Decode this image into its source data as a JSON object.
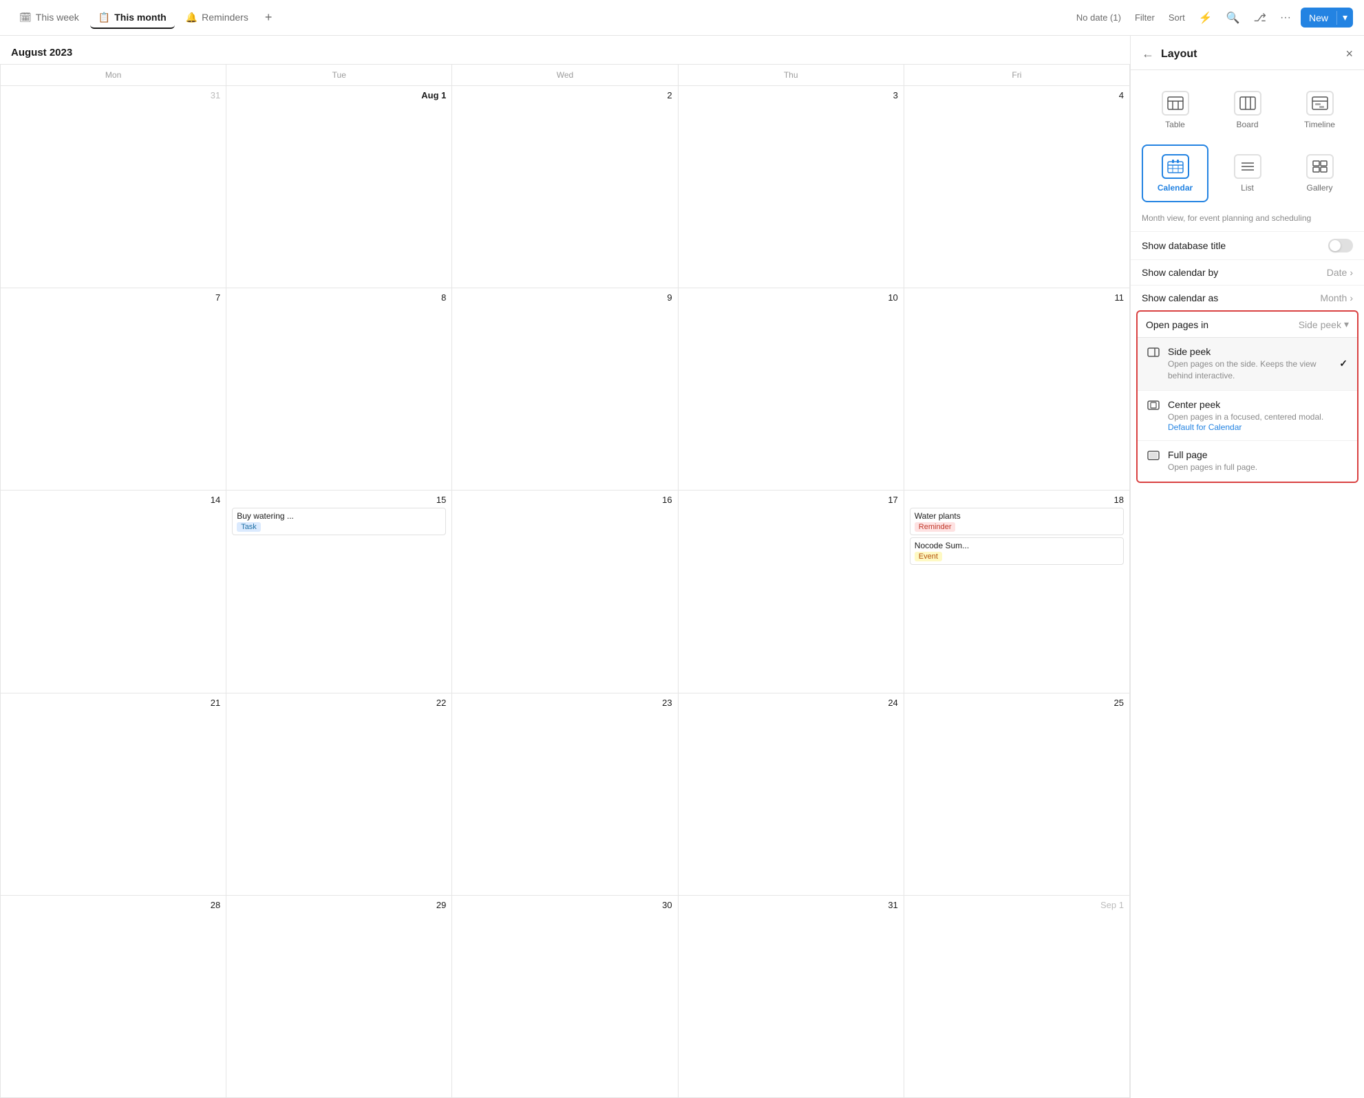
{
  "tabs": [
    {
      "id": "this-week",
      "label": "This week",
      "icon": "🗓",
      "active": false
    },
    {
      "id": "this-month",
      "label": "This month",
      "icon": "📋",
      "active": true
    },
    {
      "id": "reminders",
      "label": "Reminders",
      "icon": "🔔",
      "active": false
    }
  ],
  "topbar_add": "+",
  "topbar_right": {
    "no_date": "No date (1)",
    "filter": "Filter",
    "sort": "Sort",
    "lightning": "⚡",
    "search": "🔍",
    "branch": "⎇",
    "more": "···",
    "new": "New"
  },
  "calendar": {
    "title": "August 2023",
    "day_headers": [
      "Mon",
      "Tue",
      "Wed",
      "Thu",
      "Fri"
    ],
    "weeks": [
      [
        {
          "num": "31",
          "other": true,
          "events": []
        },
        {
          "num": "Aug 1",
          "bold": true,
          "events": []
        },
        {
          "num": "2",
          "events": []
        },
        {
          "num": "3",
          "events": []
        },
        {
          "num": "4",
          "events": []
        }
      ],
      [
        {
          "num": "7",
          "events": []
        },
        {
          "num": "8",
          "events": []
        },
        {
          "num": "9",
          "events": []
        },
        {
          "num": "10",
          "events": []
        },
        {
          "num": "11",
          "events": []
        }
      ],
      [
        {
          "num": "14",
          "events": []
        },
        {
          "num": "15",
          "events": [
            {
              "title": "Buy watering ...",
              "tag": "Task",
              "tag_class": "tag-task"
            }
          ]
        },
        {
          "num": "16",
          "events": []
        },
        {
          "num": "17",
          "events": []
        },
        {
          "num": "18",
          "events": [
            {
              "title": "Water plants",
              "tag": "Reminder",
              "tag_class": "tag-reminder"
            },
            {
              "title": "Nocode Sum...",
              "tag": "Event",
              "tag_class": "tag-event"
            }
          ]
        }
      ],
      [
        {
          "num": "21",
          "events": []
        },
        {
          "num": "22",
          "events": []
        },
        {
          "num": "23",
          "events": []
        },
        {
          "num": "24",
          "events": []
        },
        {
          "num": "25",
          "events": []
        }
      ],
      [
        {
          "num": "28",
          "events": []
        },
        {
          "num": "29",
          "events": []
        },
        {
          "num": "30",
          "events": []
        },
        {
          "num": "31",
          "events": []
        },
        {
          "num": "Sep 1",
          "other": true,
          "events": []
        }
      ]
    ]
  },
  "panel": {
    "title": "Layout",
    "back": "←",
    "close": "×",
    "layout_options": [
      {
        "id": "table",
        "label": "Table",
        "icon": "table"
      },
      {
        "id": "board",
        "label": "Board",
        "icon": "board"
      },
      {
        "id": "timeline",
        "label": "Timeline",
        "icon": "timeline"
      },
      {
        "id": "calendar",
        "label": "Calendar",
        "icon": "calendar",
        "active": true
      },
      {
        "id": "list",
        "label": "List",
        "icon": "list"
      },
      {
        "id": "gallery",
        "label": "Gallery",
        "icon": "gallery"
      }
    ],
    "description": "Month view, for event planning and scheduling",
    "rows": [
      {
        "label": "Show database title",
        "type": "toggle",
        "value": false
      },
      {
        "label": "Show calendar by",
        "type": "value",
        "value": "Date"
      },
      {
        "label": "Show calendar as",
        "type": "value",
        "value": "Month"
      }
    ],
    "open_pages": {
      "label": "Open pages in",
      "value": "Side peek"
    },
    "peek_options": [
      {
        "id": "side-peek",
        "title": "Side peek",
        "desc": "Open pages on the side. Keeps the view behind interactive.",
        "selected": true
      },
      {
        "id": "center-peek",
        "title": "Center peek",
        "desc": "Open pages in a focused, centered modal.",
        "link": "Default for Calendar",
        "selected": false
      },
      {
        "id": "full-page",
        "title": "Full page",
        "desc": "Open pages in full page.",
        "selected": false
      }
    ]
  }
}
